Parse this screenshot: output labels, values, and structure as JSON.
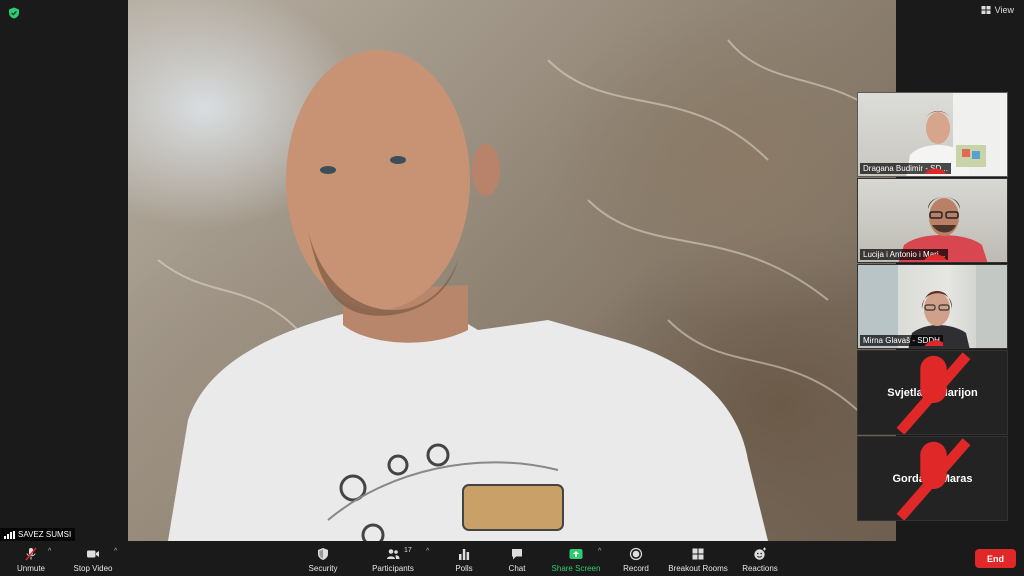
{
  "window": {
    "view_label": "View"
  },
  "main_speaker": {
    "name": "SAVEZ SUMSI"
  },
  "gallery": [
    {
      "name": "Dragana Budimir - SD...",
      "type": "video",
      "muted": true
    },
    {
      "name": "Lucija i Antonio i Mari...",
      "type": "video",
      "muted": true
    },
    {
      "name": "Mirna Glavaš - SDDH",
      "type": "video",
      "muted": true
    },
    {
      "name": "Svjetlana Marijon",
      "type": "name-only",
      "muted": true
    },
    {
      "name": "Gordana Maras",
      "type": "name-only",
      "muted": true
    }
  ],
  "toolbar": {
    "unmute": "Unmute",
    "stop_video": "Stop Video",
    "security": "Security",
    "participants": "Participants",
    "participants_count": "17",
    "polls": "Polls",
    "chat": "Chat",
    "share_screen": "Share Screen",
    "record": "Record",
    "breakout_rooms": "Breakout Rooms",
    "reactions": "Reactions",
    "end": "End"
  },
  "icons": {
    "encryption": "shield-check-icon",
    "view": "grid-icon",
    "unmute": "mic-muted-icon",
    "stop_video": "video-camera-icon",
    "security": "shield-icon",
    "participants": "people-icon",
    "polls": "bar-chart-icon",
    "chat": "chat-bubble-icon",
    "share_screen": "share-arrow-icon",
    "record": "record-icon",
    "breakout_rooms": "grid-squares-icon",
    "reactions": "emoji-icon"
  },
  "colors": {
    "background": "#1a1a1a",
    "end_button": "#e02828",
    "share_screen": "#2ecc71",
    "shield": "#2ecc71",
    "muted_red": "#e02828"
  }
}
